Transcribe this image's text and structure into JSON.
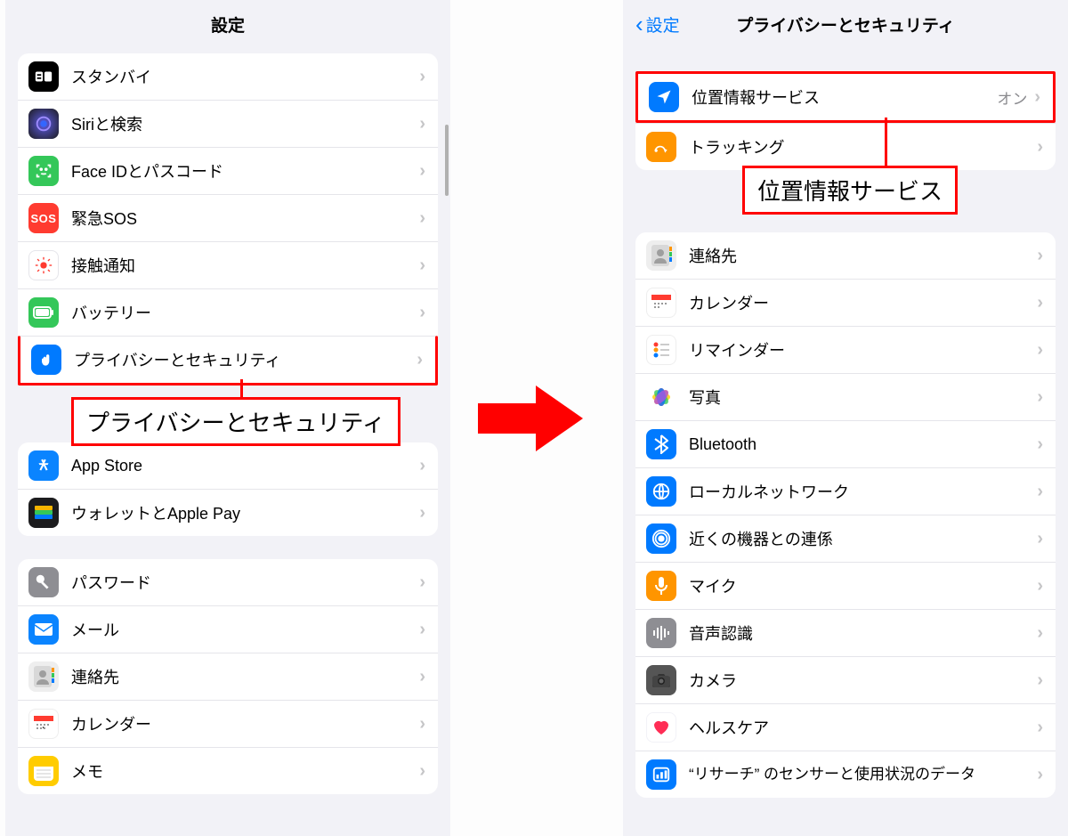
{
  "left": {
    "title": "設定",
    "callout": "プライバシーとセキュリティ",
    "group1": [
      {
        "label": "スタンバイ"
      },
      {
        "label": "Siriと検索"
      },
      {
        "label": "Face IDとパスコード"
      },
      {
        "label": "緊急SOS"
      },
      {
        "label": "接触通知"
      },
      {
        "label": "バッテリー"
      },
      {
        "label": "プライバシーとセキュリティ"
      }
    ],
    "group2": [
      {
        "label": "App Store"
      },
      {
        "label": "ウォレットとApple Pay"
      }
    ],
    "group3": [
      {
        "label": "パスワード"
      },
      {
        "label": "メール"
      },
      {
        "label": "連絡先"
      },
      {
        "label": "カレンダー"
      },
      {
        "label": "メモ"
      }
    ]
  },
  "right": {
    "back": "設定",
    "title": "プライバシーとセキュリティ",
    "callout": "位置情報サービス",
    "group1": [
      {
        "label": "位置情報サービス",
        "value": "オン"
      },
      {
        "label": "トラッキング"
      }
    ],
    "group2": [
      {
        "label": "連絡先"
      },
      {
        "label": "カレンダー"
      },
      {
        "label": "リマインダー"
      },
      {
        "label": "写真"
      },
      {
        "label": "Bluetooth"
      },
      {
        "label": "ローカルネットワーク"
      },
      {
        "label": "近くの機器との連係"
      },
      {
        "label": "マイク"
      },
      {
        "label": "音声認識"
      },
      {
        "label": "カメラ"
      },
      {
        "label": "ヘルスケア"
      },
      {
        "label": "“リサーチ” のセンサーと使用状況のデータ"
      }
    ]
  }
}
